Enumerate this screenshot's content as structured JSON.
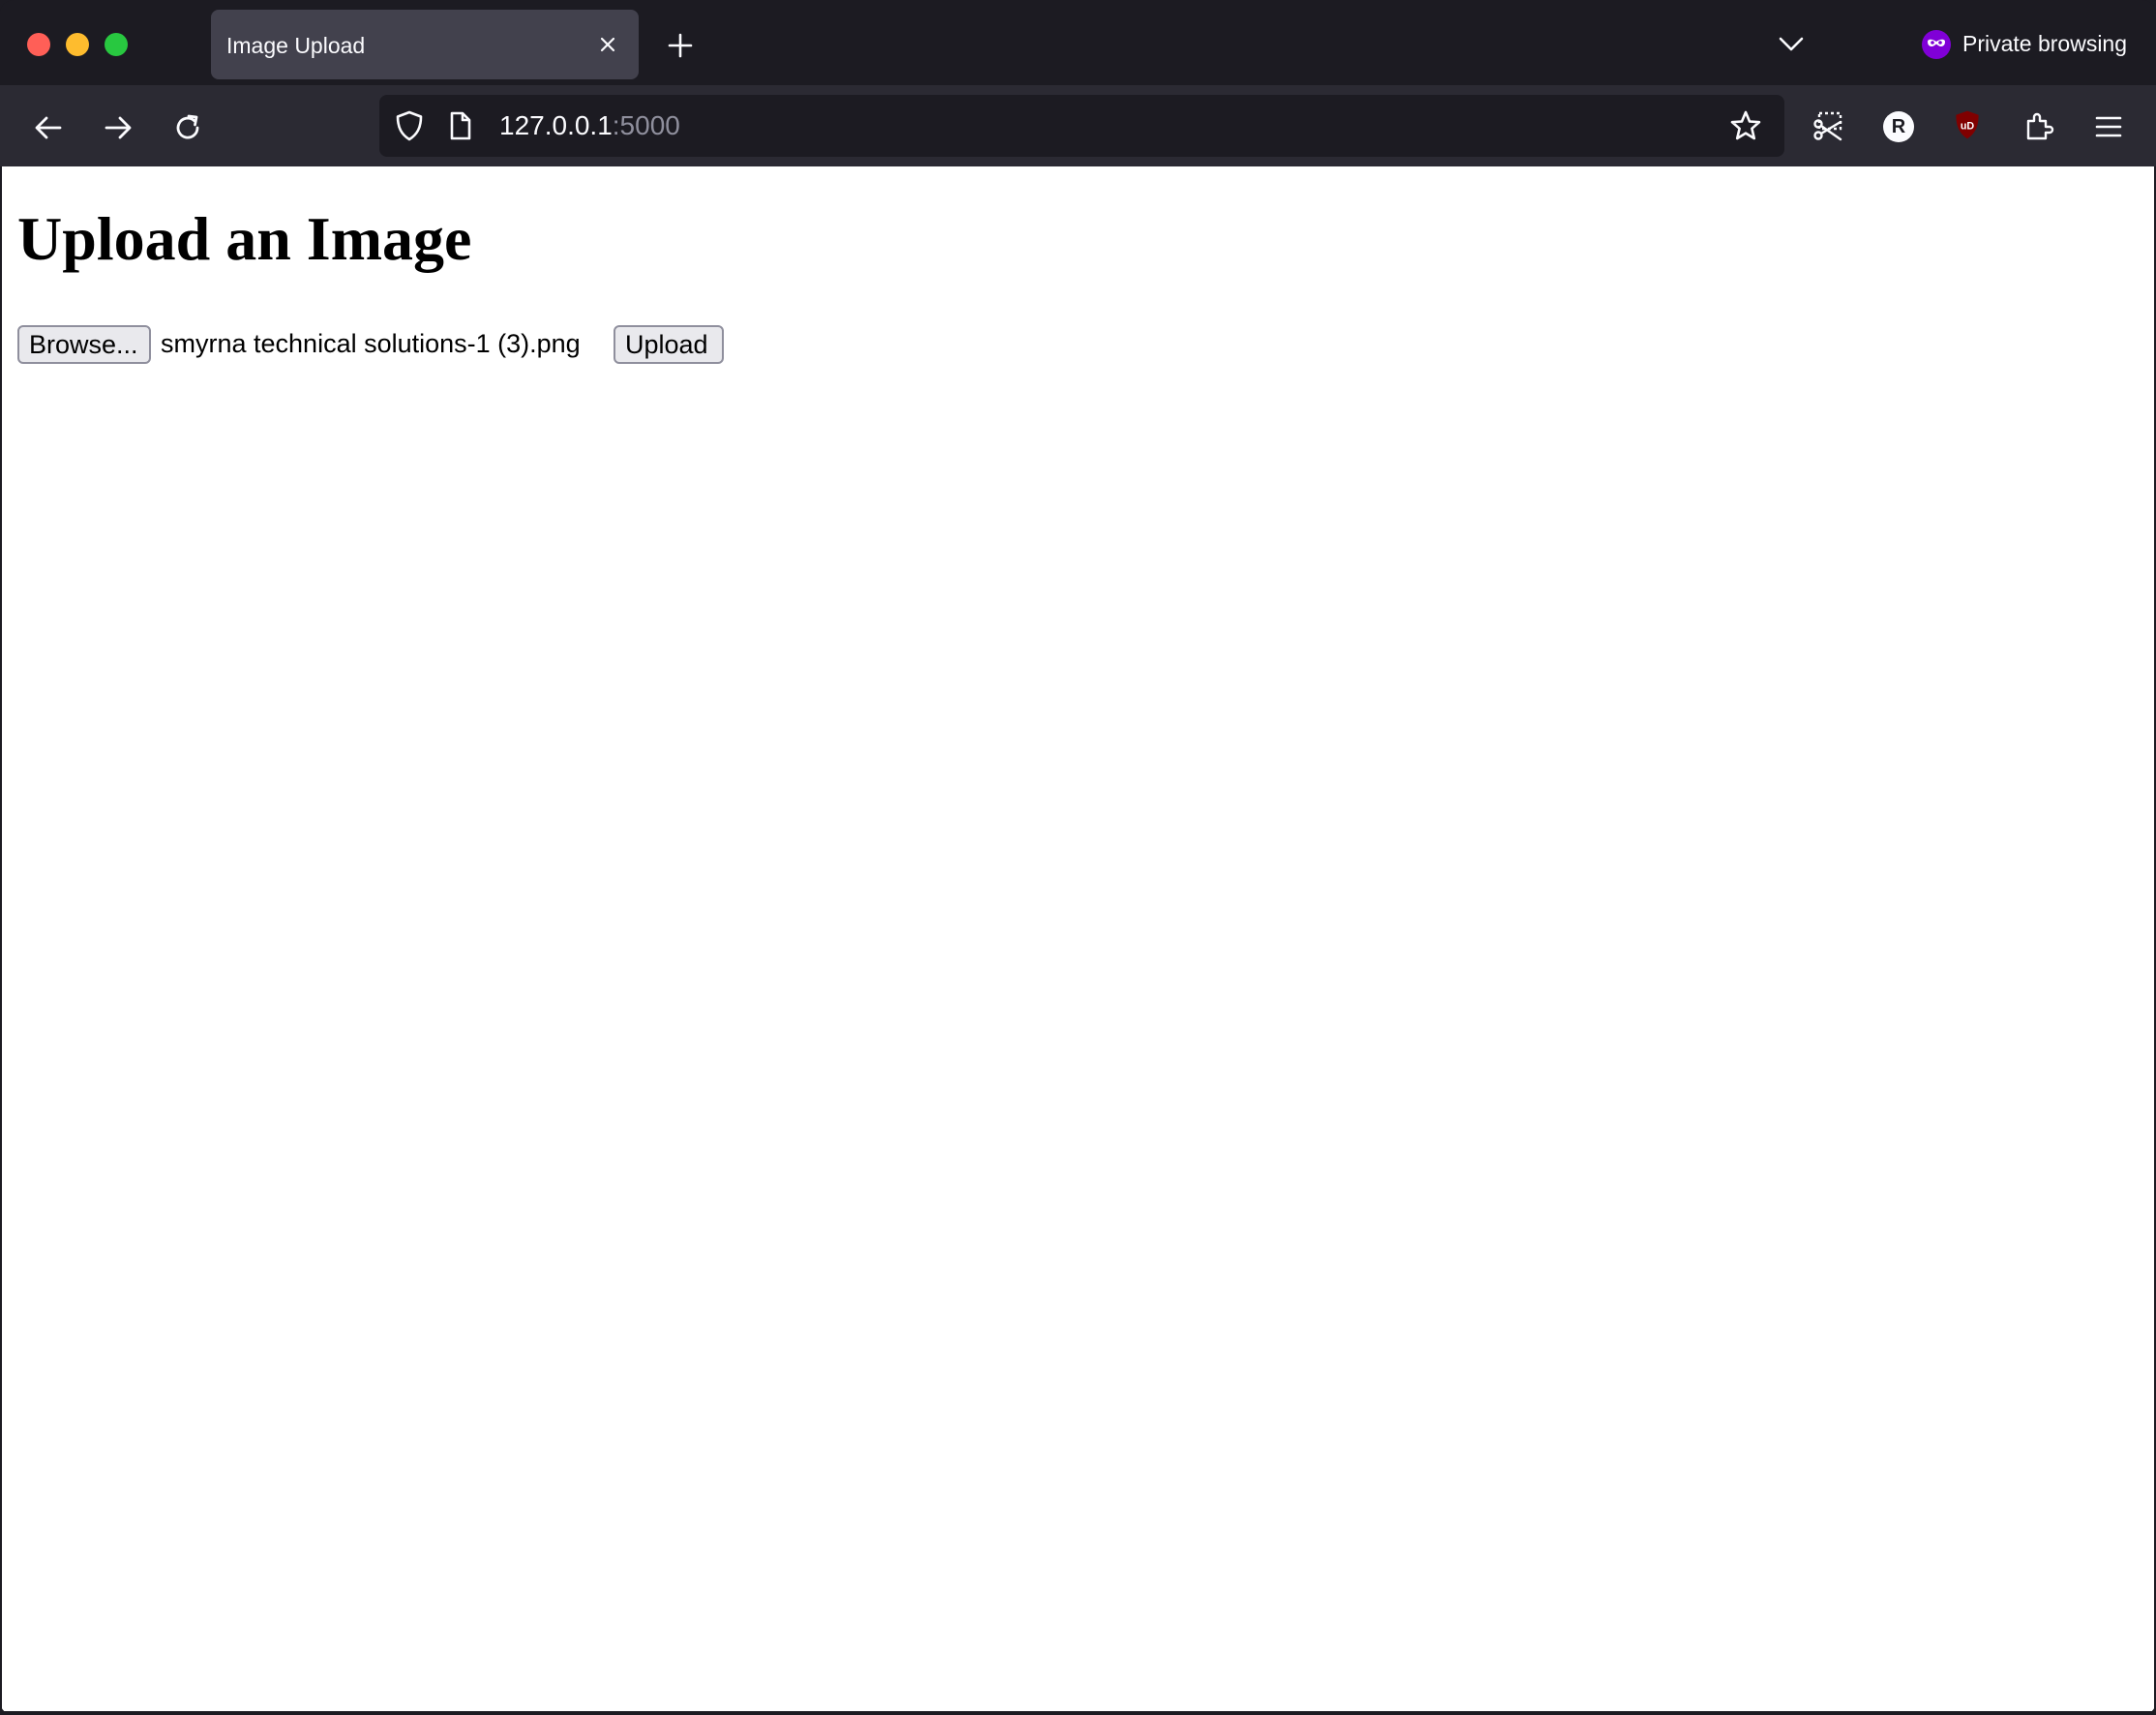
{
  "browser": {
    "tab": {
      "title": "Image Upload"
    },
    "private_label": "Private browsing",
    "url": {
      "host": "127.0.0.1",
      "port": ":5000"
    },
    "profile_initial": "R",
    "extension_badge": "uD",
    "colors": {
      "chrome_dark": "#1c1b22",
      "tab_active": "#42414d",
      "navbar": "#2b2a33",
      "private_purple": "#8000d7",
      "ublock_red": "#800000"
    },
    "icons": [
      "back-arrow-icon",
      "forward-arrow-icon",
      "reload-icon",
      "shield-icon",
      "page-icon",
      "bookmark-star-icon",
      "screenshot-icon",
      "profile-icon",
      "ublock-icon",
      "extensions-icon",
      "menu-icon",
      "private-mask-icon",
      "chevron-down-icon",
      "plus-icon",
      "close-icon"
    ]
  },
  "page": {
    "title": "Upload an Image",
    "browse_label": "Browse...",
    "file_name": "smyrna technical solutions-1 (3).png",
    "upload_label": "Upload"
  }
}
